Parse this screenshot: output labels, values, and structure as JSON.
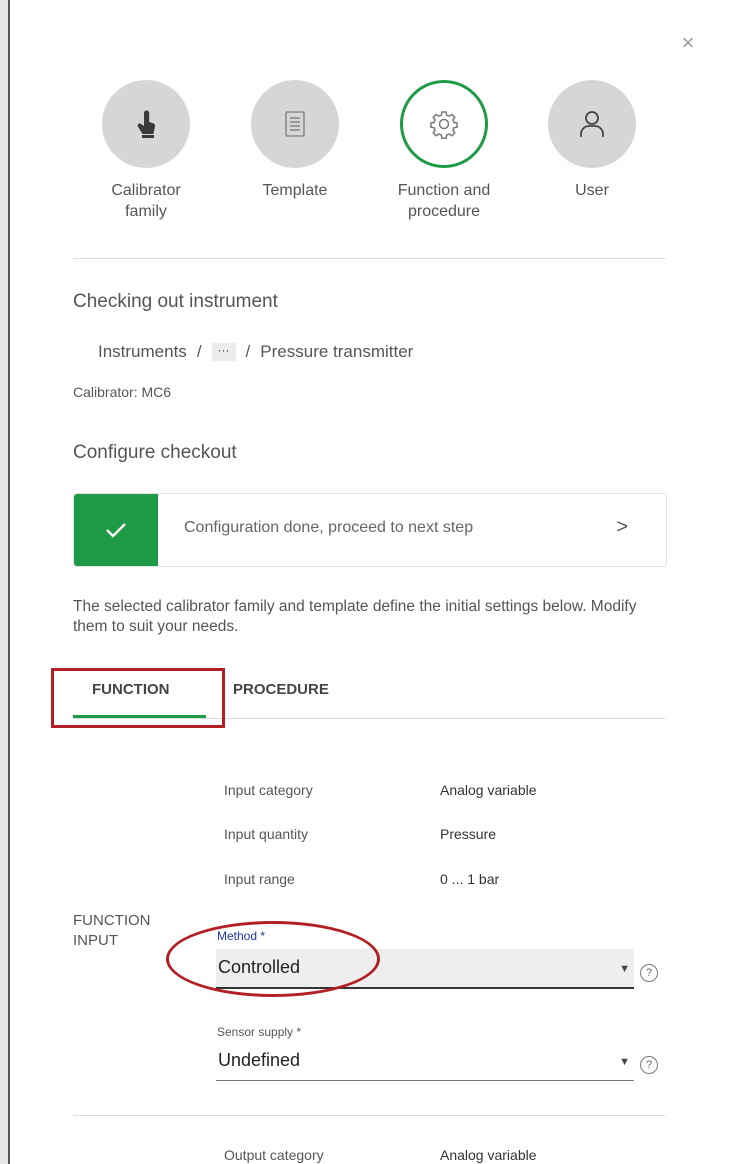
{
  "dialog": {
    "close_label": "×"
  },
  "steps": [
    {
      "label": "Calibrator family",
      "icon": "touch-icon",
      "state": "done"
    },
    {
      "label": "Template",
      "icon": "document-icon",
      "state": "done"
    },
    {
      "label": "Function and procedure",
      "icon": "gear-icon",
      "state": "active"
    },
    {
      "label": "User",
      "icon": "user-icon",
      "state": "pending"
    }
  ],
  "checkout": {
    "title": "Checking out instrument",
    "breadcrumb": {
      "root": "Instruments",
      "separator": "/",
      "more": "···",
      "leaf": "Pressure transmitter"
    },
    "calibrator": "Calibrator: MC6"
  },
  "configure": {
    "title": "Configure checkout",
    "status_text": "Configuration done, proceed to next step",
    "status_chevron": ">",
    "info": "The selected calibrator family and template define the initial settings below. Modify them to suit your needs."
  },
  "tabs": [
    {
      "label": "FUNCTION",
      "selected": true
    },
    {
      "label": "PROCEDURE",
      "selected": false
    }
  ],
  "function_input": {
    "section_label": "FUNCTION INPUT",
    "rows": [
      {
        "label": "Input category",
        "value": "Analog variable"
      },
      {
        "label": "Input quantity",
        "value": "Pressure"
      },
      {
        "label": "Input range",
        "value": "0 ... 1 bar"
      }
    ],
    "method": {
      "label": "Method *",
      "value": "Controlled",
      "help": "?"
    },
    "sensor_supply": {
      "label": "Sensor supply *",
      "value": "Undefined",
      "help": "?"
    }
  },
  "function_output": {
    "rows": [
      {
        "label": "Output category",
        "value": "Analog variable"
      }
    ]
  },
  "colors": {
    "accent_green": "#1f9a46",
    "highlight_red": "#b21f24",
    "method_label_blue": "#1a3aa6"
  }
}
